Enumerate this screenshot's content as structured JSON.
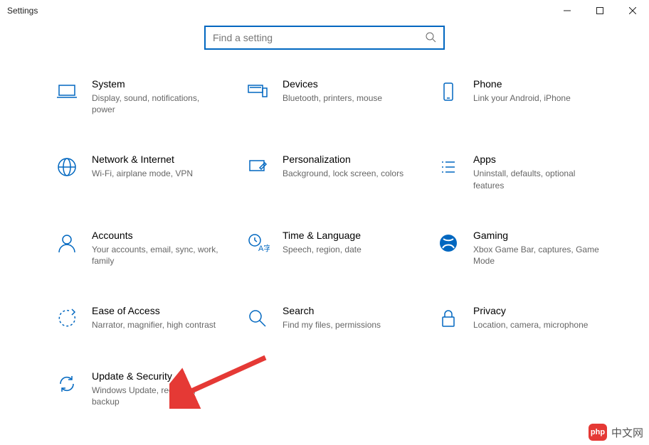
{
  "window": {
    "title": "Settings"
  },
  "search": {
    "placeholder": "Find a setting"
  },
  "categories": [
    {
      "id": "system",
      "title": "System",
      "desc": "Display, sound, notifications, power"
    },
    {
      "id": "devices",
      "title": "Devices",
      "desc": "Bluetooth, printers, mouse"
    },
    {
      "id": "phone",
      "title": "Phone",
      "desc": "Link your Android, iPhone"
    },
    {
      "id": "network",
      "title": "Network & Internet",
      "desc": "Wi-Fi, airplane mode, VPN"
    },
    {
      "id": "personalization",
      "title": "Personalization",
      "desc": "Background, lock screen, colors"
    },
    {
      "id": "apps",
      "title": "Apps",
      "desc": "Uninstall, defaults, optional features"
    },
    {
      "id": "accounts",
      "title": "Accounts",
      "desc": "Your accounts, email, sync, work, family"
    },
    {
      "id": "time",
      "title": "Time & Language",
      "desc": "Speech, region, date"
    },
    {
      "id": "gaming",
      "title": "Gaming",
      "desc": "Xbox Game Bar, captures, Game Mode"
    },
    {
      "id": "ease",
      "title": "Ease of Access",
      "desc": "Narrator, magnifier, high contrast"
    },
    {
      "id": "search_cat",
      "title": "Search",
      "desc": "Find my files, permissions"
    },
    {
      "id": "privacy",
      "title": "Privacy",
      "desc": "Location, camera, microphone"
    },
    {
      "id": "update",
      "title": "Update & Security",
      "desc": "Windows Update, recovery, backup"
    }
  ],
  "watermark": {
    "logo_text": "php",
    "text": "中文网"
  }
}
